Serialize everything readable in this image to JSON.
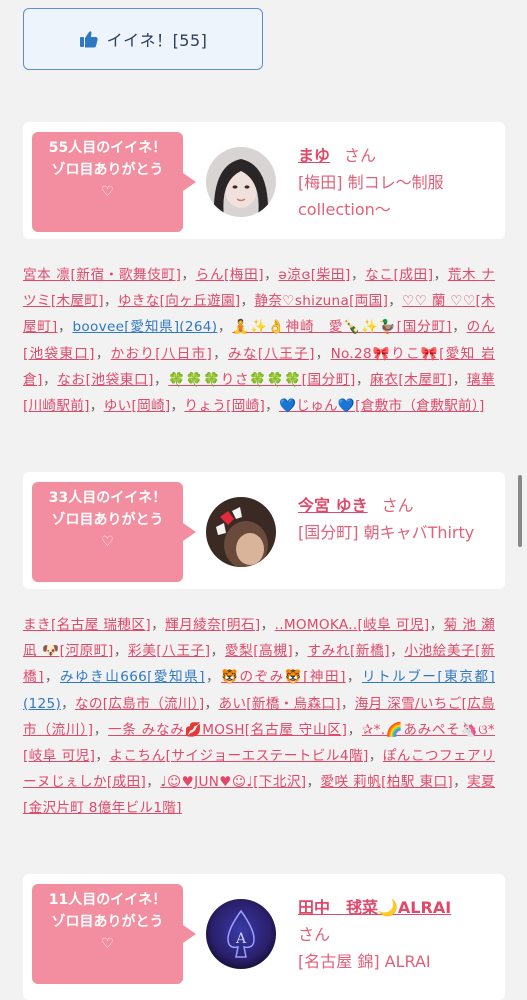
{
  "like_button": {
    "label": "イイネ！[55]"
  },
  "cards": [
    {
      "rank_text": "55人目のイイネ！",
      "thanks_text": "ゾロ目ありがとう",
      "heart": "♡",
      "name": "まゆ",
      "honorific": "さん",
      "area_shop": "[梅田] 制コレ～制服collection～",
      "likers": [
        {
          "t": "宮本 凛[新宿・歌舞伎町]"
        },
        {
          "t": "らん[梅田]"
        },
        {
          "t": "ə涼ɞ[柴田]"
        },
        {
          "t": "なこ[成田]"
        },
        {
          "t": "荒木 ナツミ[木屋町]"
        },
        {
          "t": "ゆきな[向ヶ丘遊園]"
        },
        {
          "t": "静奈♡shizuna[両国]"
        },
        {
          "t": "♡♡ 蘭 ♡♡[木屋町]"
        },
        {
          "t": "boovee[愛知県](264)",
          "c": "blue"
        },
        {
          "t": "🧘✨👌神崎　愛🍾✨🦆[国分町]"
        },
        {
          "t": "のん[池袋東口]"
        },
        {
          "t": "かおり[八日市]"
        },
        {
          "t": "みな[八王子]"
        },
        {
          "t": "No.28🎀りこ🎀[愛知 岩倉]"
        },
        {
          "t": "なお[池袋東口]"
        },
        {
          "t": "🍀🍀🍀りさ🍀🍀🍀[国分町]"
        },
        {
          "t": "麻衣[木屋町]"
        },
        {
          "t": "璃華[川崎駅前]"
        },
        {
          "t": "ゆい[岡崎]"
        },
        {
          "t": "りょう[岡崎]"
        },
        {
          "t": "💙じゅん💙[倉敷市（倉敷駅前）]"
        }
      ]
    },
    {
      "rank_text": "33人目のイイネ！",
      "thanks_text": "ゾロ目ありがとう",
      "heart": "♡",
      "name": "今宮 ゆき",
      "honorific": "さん",
      "area_shop": "[国分町] 朝キャバThirty",
      "likers": [
        {
          "t": "まき[名古屋 瑞穂区]"
        },
        {
          "t": "輝月綾奈[明石]"
        },
        {
          "t": "..MOMOKA..[岐阜 可児]"
        },
        {
          "t": "菊 池 瀬 凪 🐶[河原町]"
        },
        {
          "t": "彩美[八王子]"
        },
        {
          "t": "愛梨[高槻]"
        },
        {
          "t": "すみれ[新橋]"
        },
        {
          "t": "小池絵美子[新橋]"
        },
        {
          "t": "みゆき山666[愛知県]",
          "c": "blue"
        },
        {
          "t": "🐯のぞみ🐯[神田]"
        },
        {
          "t": "リトルブー[東京都](125)",
          "c": "blue"
        },
        {
          "t": "なの[広島市（流川）]"
        },
        {
          "t": "あい[新橋・烏森口]"
        },
        {
          "t": "海月 深雪/いちご[広島市（流川）]"
        },
        {
          "t": "一条 みなみ💋MOSH[名古屋 守山区]"
        },
        {
          "t": "✰*.🌈あみぺそ🦄ଓ*[岐阜 可児]"
        },
        {
          "t": "よこちん[サイジョーエステートビル4階]"
        },
        {
          "t": "ぽんこつフェアリーヌじぇしか[成田]"
        },
        {
          "t": "♩☺♥JUN♥☺♩[下北沢]"
        },
        {
          "t": "愛咲 莉帆[柏駅 東口]"
        },
        {
          "t": "実夏[金沢片町 8億年ビル1階]"
        }
      ]
    },
    {
      "rank_text": "11人目のイイネ！",
      "thanks_text": "ゾロ目ありがとう",
      "heart": "♡",
      "name": "田中　毬菜🌙ALRAI",
      "honorific": "さん",
      "area_shop": "[名古屋 錦] ALRAI"
    }
  ],
  "colors": {
    "accent": "#f28ea0",
    "link": "#e0496a",
    "link_blue": "#2f78c4",
    "button_border": "#5b8fd0"
  },
  "icons": {
    "like": "thumbs-up-icon"
  }
}
